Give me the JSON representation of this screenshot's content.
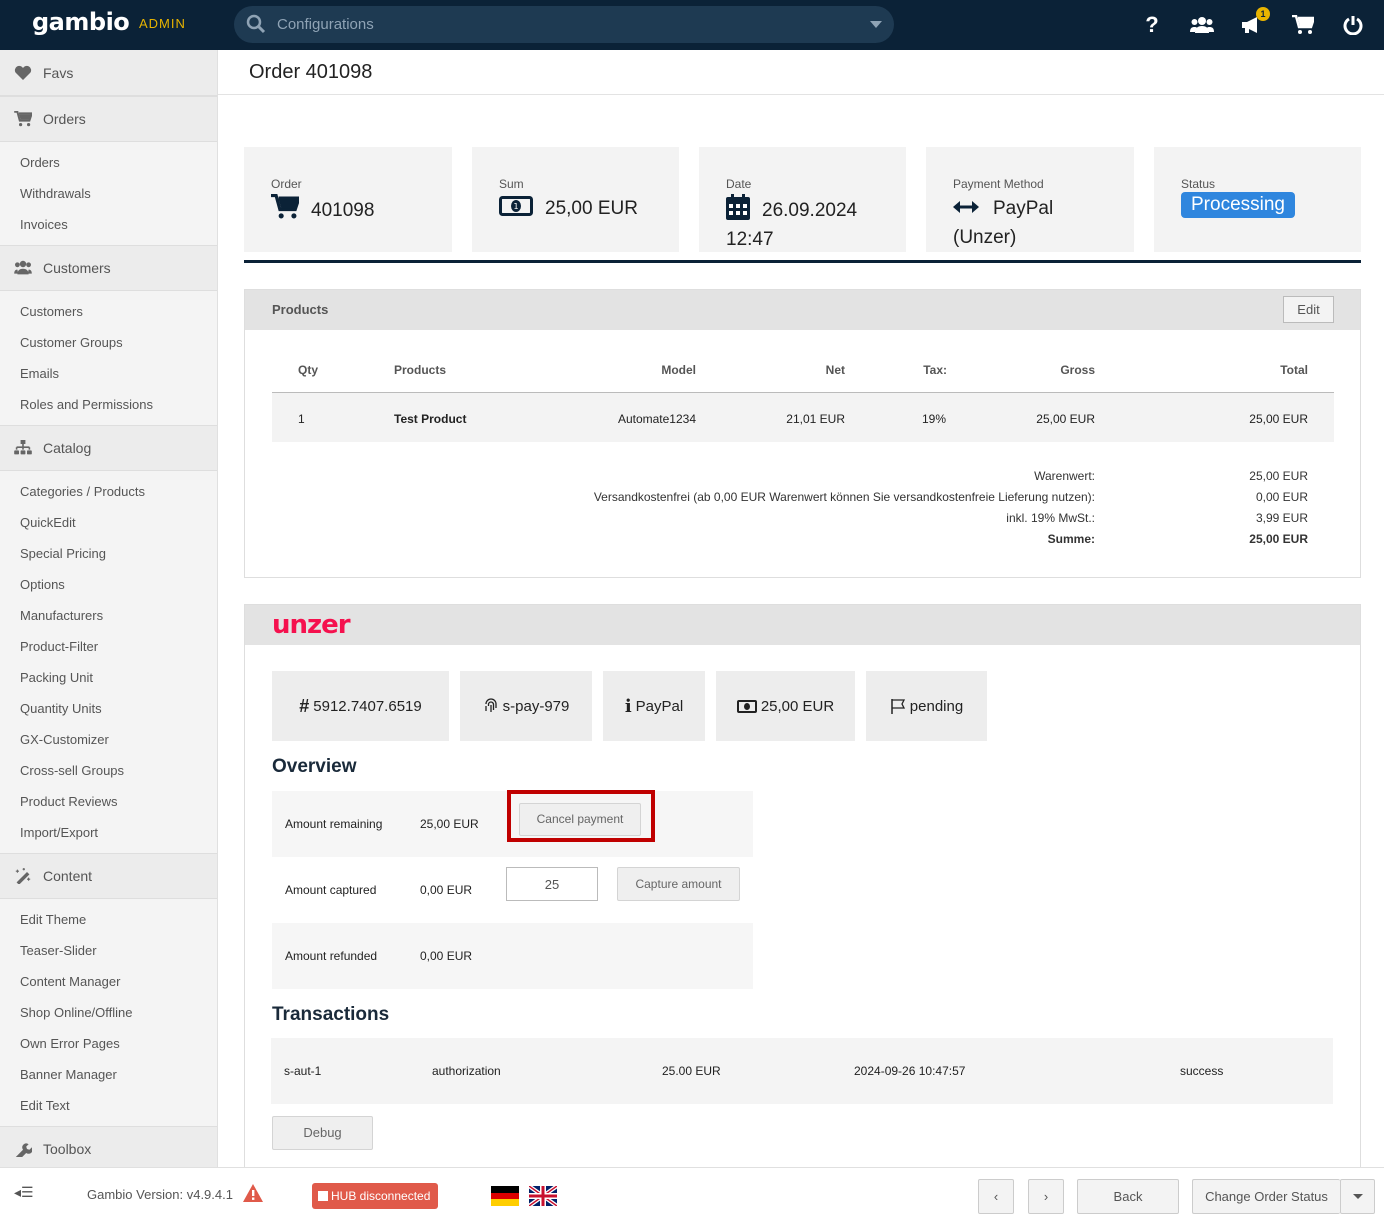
{
  "header": {
    "logo": "gambio",
    "admin_label": "ADMIN",
    "search_placeholder": "Configurations",
    "notification_count": "1",
    "icons": [
      "help-icon",
      "customers-icon",
      "megaphone-icon",
      "cart-icon",
      "power-icon"
    ]
  },
  "sidebar": {
    "favs": "Favs",
    "groups": [
      {
        "label": "Orders",
        "icon": "cart-icon",
        "items": [
          "Orders",
          "Withdrawals",
          "Invoices"
        ]
      },
      {
        "label": "Customers",
        "icon": "users-icon",
        "items": [
          "Customers",
          "Customer Groups",
          "Emails",
          "Roles and Permissions"
        ]
      },
      {
        "label": "Catalog",
        "icon": "sitemap-icon",
        "items": [
          "Categories / Products",
          "QuickEdit",
          "Special Pricing",
          "Options",
          "Manufacturers",
          "Product-Filter",
          "Packing Unit",
          "Quantity Units",
          "GX-Customizer",
          "Cross-sell Groups",
          "Product Reviews",
          "Import/Export"
        ]
      },
      {
        "label": "Content",
        "icon": "magic-wand-icon",
        "items": [
          "Edit Theme",
          "Teaser-Slider",
          "Content Manager",
          "Shop Online/Offline",
          "Own Error Pages",
          "Banner Manager",
          "Edit Text"
        ]
      },
      {
        "label": "Toolbox",
        "icon": "wrench-icon",
        "items": []
      }
    ]
  },
  "page": {
    "title": "Order 401098"
  },
  "summary": {
    "order_label": "Order",
    "order_value": "401098",
    "sum_label": "Sum",
    "sum_value": "25,00 EUR",
    "date_label": "Date",
    "date_value": "26.09.2024",
    "time_value": "12:47",
    "payment_label": "Payment Method",
    "payment_value": "PayPal",
    "payment_sub": "(Unzer)",
    "status_label": "Status",
    "status_value": "Processing",
    "status_color": "#2f86de"
  },
  "products": {
    "title": "Products",
    "edit_label": "Edit",
    "columns": [
      "Qty",
      "Products",
      "Model",
      "Net",
      "Tax:",
      "Gross",
      "Total"
    ],
    "rows": [
      {
        "qty": "1",
        "name": "Test Product",
        "model": "Automate1234",
        "net": "21,01 EUR",
        "tax": "19%",
        "gross": "25,00 EUR",
        "total": "25,00 EUR"
      }
    ],
    "totals": [
      {
        "label": "Warenwert:",
        "value": "25,00 EUR"
      },
      {
        "label": "Versandkostenfrei (ab 0,00 EUR Warenwert können Sie versandkostenfreie Lieferung nutzen):",
        "value": "0,00 EUR"
      },
      {
        "label": "inkl. 19% MwSt.:",
        "value": "3,99 EUR"
      },
      {
        "label": "Summe:",
        "value": "25,00 EUR"
      }
    ]
  },
  "unzer": {
    "logo": "unzer",
    "brand_color": "#f5114e",
    "chips": [
      {
        "icon": "hash-icon",
        "text": "5912.7407.6519"
      },
      {
        "icon": "fingerprint-icon",
        "text": "s-pay-979"
      },
      {
        "icon": "info-icon",
        "text": "PayPal"
      },
      {
        "icon": "money-icon",
        "text": "25,00 EUR"
      },
      {
        "icon": "flag-icon",
        "text": "pending"
      }
    ],
    "overview_title": "Overview",
    "overview": [
      {
        "label": "Amount remaining",
        "value": "25,00 EUR"
      },
      {
        "label": "Amount captured",
        "value": "0,00 EUR"
      },
      {
        "label": "Amount refunded",
        "value": "0,00 EUR"
      }
    ],
    "cancel_label": "Cancel payment",
    "capture_input_value": "25",
    "capture_label": "Capture amount",
    "transactions_title": "Transactions",
    "transactions": [
      {
        "id": "s-aut-1",
        "type": "authorization",
        "amount": "25.00 EUR",
        "date": "2024-09-26 10:47:57",
        "result": "success"
      }
    ],
    "debug_label": "Debug"
  },
  "footer": {
    "version": "Gambio Version: v4.9.4.1",
    "hub": "HUB disconnected",
    "back": "Back",
    "change_status": "Change Order Status"
  }
}
